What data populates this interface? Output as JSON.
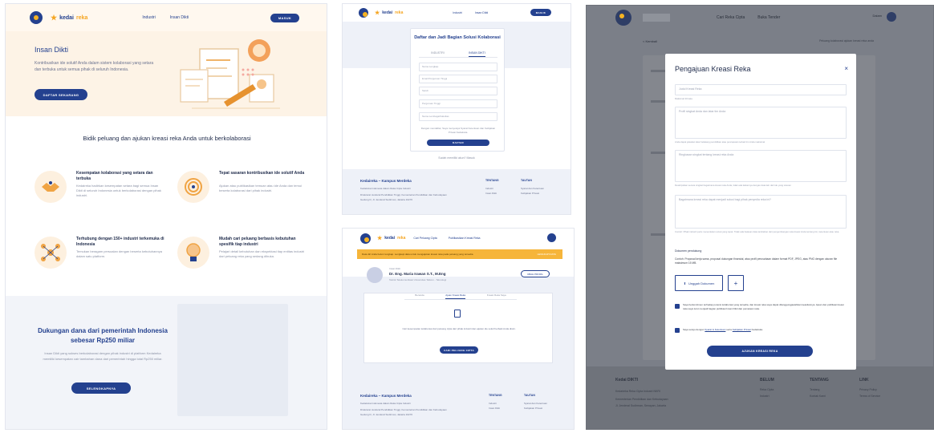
{
  "brand": {
    "name_part1": "kedai",
    "name_part2": "reka"
  },
  "panel1": {
    "nav": [
      "Industri",
      "Insan Dikti"
    ],
    "login": "MASUK",
    "hero": {
      "title": "Insan Dikti",
      "desc": "Kontribusikan ide solutif Anda dalam sistem kolaborasi yang setara dan terbuka untuk semua pihak di seluruh Indonesia.",
      "cta": "DAFTAR SEKARANG"
    },
    "section_title": "Bidik peluang dan ajukan kreasi reka Anda untuk berkolaborasi",
    "features": [
      {
        "title": "Kesempatan kolaborasi yang setara dan terbuka",
        "desc": "Kedaireka hadirkan kesempatan setara bagi semua Insan Dikti di seluruh Indonesia untuk berkolaborasi dengan pihak industri."
      },
      {
        "title": "Tepat sasaran kontribusikan ide solutif Anda",
        "desc": "Ajukan atau publikasikan temuan atau ide Anda dan temui beserta kolaborasi dari pihak industri."
      },
      {
        "title": "Terhubung dengan 150+ industri terkemuka di Indonesia",
        "desc": "Temukan beragam persoalan dengan beserta kebutuhannya dalam satu platform."
      },
      {
        "title": "Mudah cari peluang berbasis kebutuhan spesifik tiap industri",
        "desc": "Pelajari detail kebutuhan dan ekspektasi tiap entitas industri dari peluang reka yang sedang dibuka."
      }
    ],
    "bottom": {
      "title": "Dukungan dana dari pemerintah Indonesia sebesar Rp250 miliar",
      "desc": "Insan Dikti yang sukses berkolaborasi dengan pihak industri di platform Kedaireka memiliki kesempatan cair tambahan dana dari pemerintah hingga total Rp250 miliar.",
      "cta": "SELENGKAPNYA"
    }
  },
  "panel2": {
    "nav": [
      "Industri",
      "Insan Dikti"
    ],
    "login": "MASUK",
    "card_title": "Daftar dan Jadi Bagian Solusi Kolaborasi",
    "tabs": [
      "INDUSTRI",
      "INSAN DIKTI"
    ],
    "fields": [
      "Nama Lengkap",
      "Email Perguruan Tinggi",
      "Sandi",
      "Perguruan Tinggi",
      "Nama Lembaga/Fakultas"
    ],
    "note": "Dengan mendaftar, Saya menyetujui Syarat Ketentuan dan Kebijakan Privasi Kedaireka.",
    "submit": "DAFTAR",
    "have_account": "Sudah memiliki akun? Masuk",
    "footer": {
      "brand": "Kedaireka – Kampus Merdeka",
      "lines": [
        "Kedaireka Indonesia dalam Reka Cipta Industri",
        "Direktorat Jenderal Pendidikan Tinggi, Kementerian Pendidikan dan Kebudayaan",
        "Gedung D, Jl. Jenderal Sudirman, Jakarta 10270"
      ],
      "col1_title": "TENTANG",
      "col1": [
        "Industri",
        "Insan Dikti"
      ],
      "col2_title": "TAUTAN",
      "col2": [
        "Syarat dan Ketentuan",
        "Kebijakan Privasi"
      ]
    }
  },
  "panel3": {
    "nav": [
      "Cari Peluang Cipta",
      "Publikasikan Kreasi Reka"
    ],
    "alert": "Data diri Anda belum lengkap. Lengkapi data untuk mengajukan kreasi reka pada peluang yang tersedia.",
    "alert_action": "LENGKAPI DATA",
    "profile": {
      "label": "Insan Dikti",
      "name": "Dr. Eng. Maria Irawan S.T., M.Eng",
      "inst": "Teknik Telekomunikasi Universitas Telkom - Teknologi",
      "edit": "UBAH PROFIL"
    },
    "tabs": [
      "Beranda",
      "Ajuan Kreasi Reka",
      "Kreasi Reka Saya"
    ],
    "empty": "Cari kesempatan kolaborasi dari peluang cipta dari pihak industri dan ajukan ide solutif terbaik Anda disini.",
    "cta": "CARI PELUANG CIPTA",
    "footer": {
      "brand": "Kedaireka – Kampus Merdeka",
      "lines": [
        "Kedaireka Indonesia dalam Reka Cipta Industri",
        "Direktorat Jenderal Pendidikan Tinggi, Kementerian Pendidikan dan Kebudayaan",
        "Gedung D, Jl. Jenderal Sudirman, Jakarta 10270"
      ],
      "col1_title": "TENTANG",
      "col1": [
        "Industri",
        "Insan Dikti"
      ],
      "col2_title": "TAUTAN",
      "col2": [
        "Syarat dan Ketentuan",
        "Kebijakan Privasi"
      ]
    }
  },
  "panel4": {
    "nav": [
      "Cari Reka Cipta",
      "Buka Tender"
    ],
    "right": "Dalam",
    "back": "< Kembali",
    "crumb": "Peluang kolaborasi ajukan kreasi reka anda",
    "modal": {
      "title": "Pengajuan Kreasi Reka",
      "close": "×",
      "f1_ph": "Judul Kreasi Reka",
      "f1_hint": "Maksimal 20 kata",
      "f2_ph": "Profil singkat Anda dan latar tim Anda",
      "f2_hint": "Anda dapat jelaskan latar belakang pendidikan atau pencapaian terkait tim Anda maksimal",
      "f3_ph": "Ringkasan singkat tentang kreasi reka Anda",
      "f3_hint": "Deskripsikan secara singkat bagaimana kreasi reka Anda, tidak ada kaitannya dengan data lain dari ide yang relevan",
      "f4_ph": "Bagaimana kreasi reka dapat menjadi solusi bagi pihak penyedia reka ini?",
      "f4_hint": "Contoh: Pihak industri perlu menentukan solusi yang tepat. Tidak ada batasan data tambahan dari pengembangan reka kreasi Anda tentang tim, ketentuan atau reka.",
      "doc_title": "Dokumen pendukung",
      "doc_desc": "Contoh: Proposal kerja sama, proposal dukungan finansial, atau profil perusahaan dalam format PDF, JPEG, atau PNG dengan ukuran file maksimum 15 MB.",
      "upload": "Unggah Dokumen",
      "plus": "+",
      "check1": "Saya berkomitmen terhadap potensi kolaborasi yang tersedia, dan kreasi reka saya dapat ditanggungjawabkan keasliannya. Ajuan dan publikasi kreasi reka saya turut menjadi bagian publikasi Insan Dikti dan pemetaan reka.",
      "check2_pre": "Saya setuju dengan ",
      "check2_link1": "Syarat & Ketentuan",
      "check2_mid": " serta ",
      "check2_link2": "Kebijakan Privasi",
      "check2_post": " Kedaireka.",
      "submit": "AJUKAN KREASI REKA"
    },
    "footer": {
      "brand": "Kedai DIKTI",
      "line1": "Kedaireka Reka Cipta Industri NKRI",
      "line2": "Kementerian Pendidikan dan Kebudayaan",
      "line3": "Jl. Jenderal Sudirman, Senayan, Jakarta",
      "col1_title": "BELUM",
      "col1": [
        "Reka Cipta",
        "Industri"
      ],
      "col2_title": "TENTANG",
      "col2": [
        "Tentang",
        "Kontak Kami"
      ],
      "col3_title": "LINK",
      "col3": [
        "Privacy Policy",
        "Terms of Service"
      ]
    }
  }
}
